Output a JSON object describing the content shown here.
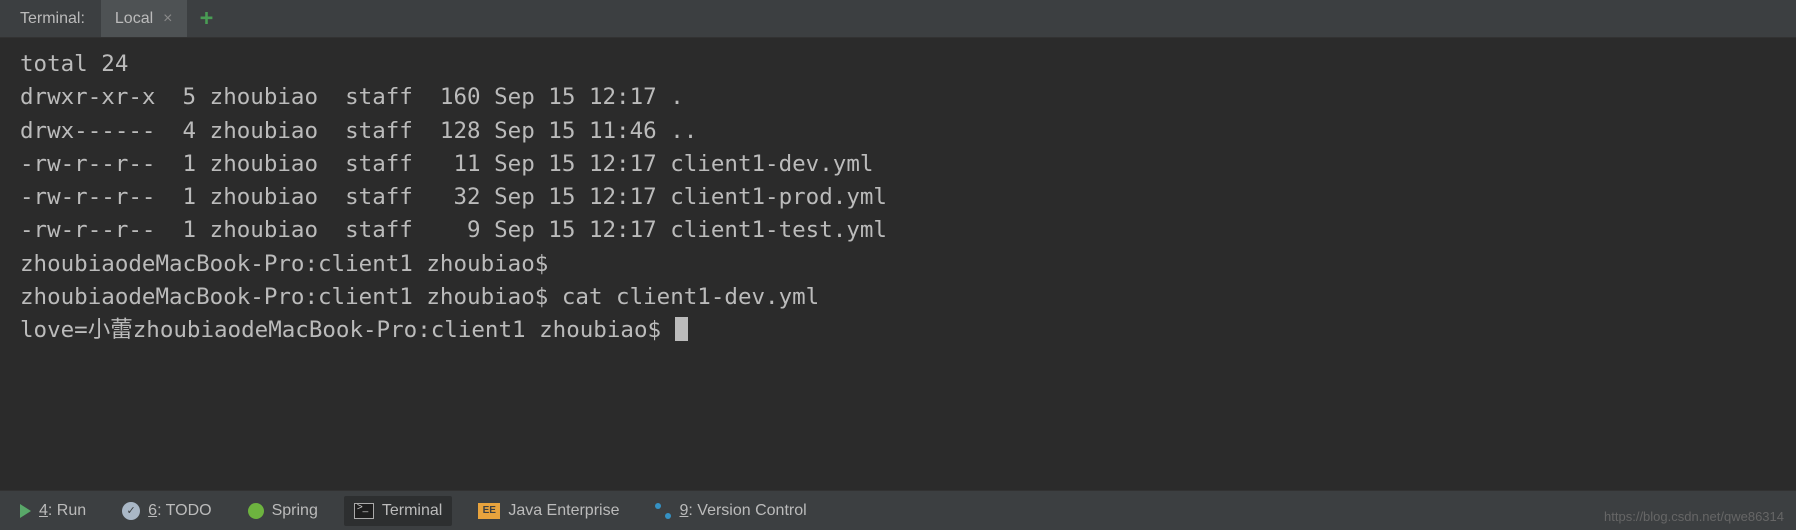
{
  "header": {
    "label": "Terminal:",
    "tab_name": "Local",
    "close_glyph": "×",
    "add_glyph": "+"
  },
  "terminal": {
    "lines": [
      "total 24",
      "drwxr-xr-x  5 zhoubiao  staff  160 Sep 15 12:17 .",
      "drwx------  4 zhoubiao  staff  128 Sep 15 11:46 ..",
      "-rw-r--r--  1 zhoubiao  staff   11 Sep 15 12:17 client1-dev.yml",
      "-rw-r--r--  1 zhoubiao  staff   32 Sep 15 12:17 client1-prod.yml",
      "-rw-r--r--  1 zhoubiao  staff    9 Sep 15 12:17 client1-test.yml",
      "zhoubiaodeMacBook-Pro:client1 zhoubiao$ ",
      "zhoubiaodeMacBook-Pro:client1 zhoubiao$ cat client1-dev.yml"
    ],
    "last_line_prefix": "love=小蕾zhoubiaodeMacBook-Pro:client1 zhoubiao$ "
  },
  "footer": {
    "run_num": "4",
    "run_label": ": Run",
    "todo_num": "6",
    "todo_label": ": TODO",
    "spring_label": "Spring",
    "terminal_label": "Terminal",
    "java_label": "Java Enterprise",
    "vcs_num": "9",
    "vcs_label": ": Version Control",
    "ee_text": "EE"
  },
  "watermark": "https://blog.csdn.net/qwe86314"
}
